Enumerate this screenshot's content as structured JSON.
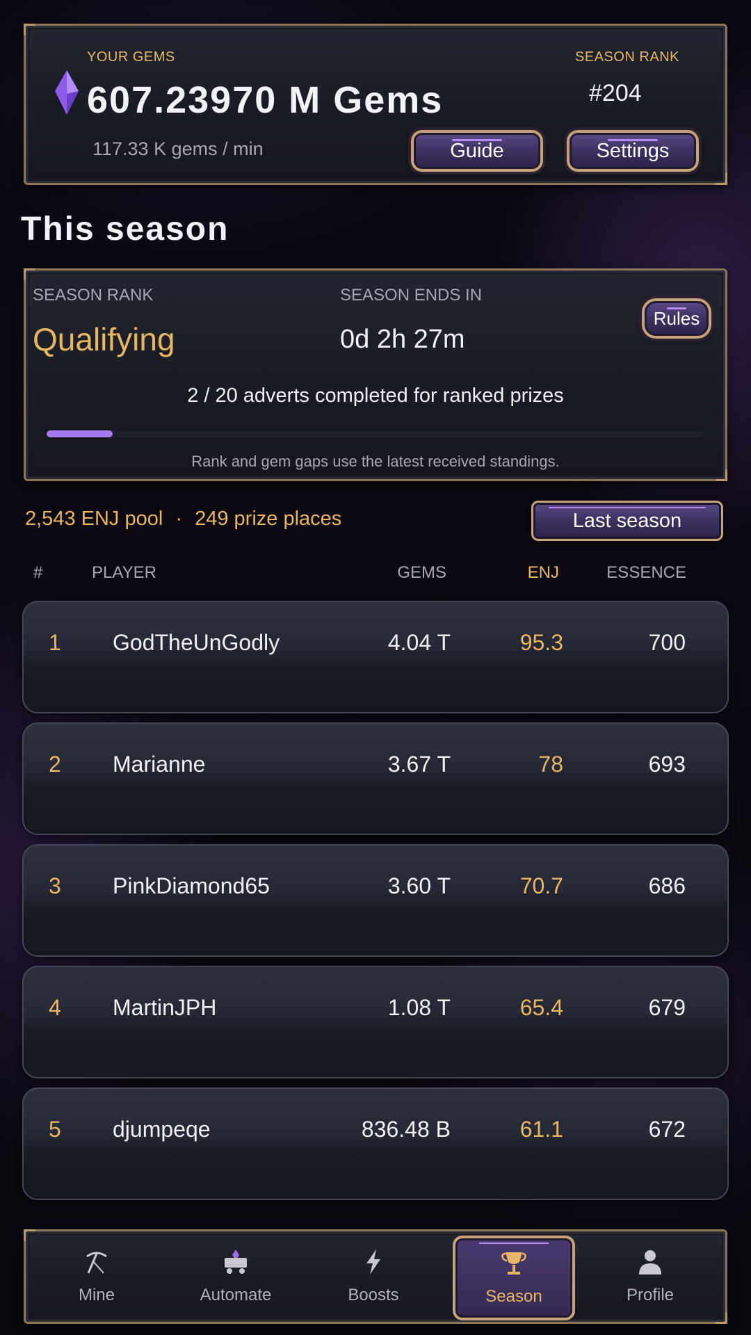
{
  "header": {
    "gems_label": "YOUR GEMS",
    "gems_value": "607.23970 M Gems",
    "gems_rate": "117.33 K gems / min",
    "rank_label": "SEASON RANK",
    "rank_value": "#204",
    "guide_button": "Guide",
    "settings_button": "Settings"
  },
  "season": {
    "title": "This season",
    "rank_label": "SEASON RANK",
    "rank_value": "Qualifying",
    "ends_label": "SEASON ENDS IN",
    "ends_value": "0d 2h 27m",
    "rules_button": "Rules",
    "adverts_text": "2 / 20 adverts completed for ranked prizes",
    "adverts_progress": 0.1,
    "note": "Rank and gem gaps use the latest received standings."
  },
  "pool": {
    "pool_text": "2,543 ENJ pool",
    "separator": "·",
    "places_text": "249 prize places",
    "last_season_button": "Last season"
  },
  "table": {
    "headers": {
      "rank": "#",
      "player": "PLAYER",
      "gems": "GEMS",
      "enj": "ENJ",
      "essence": "ESSENCE"
    },
    "rows": [
      {
        "rank": "1",
        "player": "GodTheUnGodly",
        "gems": "4.04 T",
        "enj": "95.3",
        "essence": "700"
      },
      {
        "rank": "2",
        "player": "Marianne",
        "gems": "3.67 T",
        "enj": "78",
        "essence": "693"
      },
      {
        "rank": "3",
        "player": "PinkDiamond65",
        "gems": "3.60 T",
        "enj": "70.7",
        "essence": "686"
      },
      {
        "rank": "4",
        "player": "MartinJPH",
        "gems": "1.08 T",
        "enj": "65.4",
        "essence": "679"
      },
      {
        "rank": "5",
        "player": "djumpeqe",
        "gems": "836.48 B",
        "enj": "61.1",
        "essence": "672"
      }
    ]
  },
  "nav": {
    "items": [
      {
        "label": "Mine",
        "icon": "pickaxe-icon",
        "active": false
      },
      {
        "label": "Automate",
        "icon": "minecart-icon",
        "active": false
      },
      {
        "label": "Boosts",
        "icon": "lightning-icon",
        "active": false
      },
      {
        "label": "Season",
        "icon": "trophy-icon",
        "active": true
      },
      {
        "label": "Profile",
        "icon": "person-icon",
        "active": false
      }
    ]
  },
  "colors": {
    "accent_gold": "#e8b765",
    "accent_purple": "#a679ee",
    "background": "#07060b"
  }
}
